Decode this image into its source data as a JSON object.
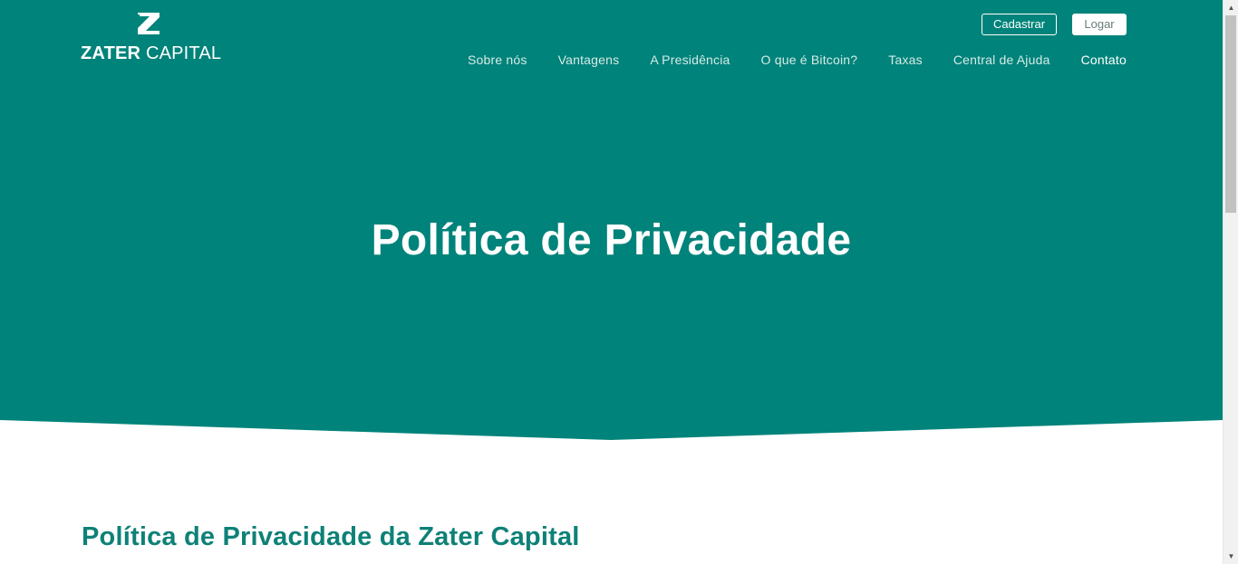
{
  "colors": {
    "brand_teal": "#00837a",
    "heading_teal": "#0e8177",
    "white": "#ffffff"
  },
  "header": {
    "logo_icon": "z-mark-icon",
    "logo_bold": "ZATER",
    "logo_light": "CAPITAL",
    "signup_label": "Cadastrar",
    "login_label": "Logar",
    "nav": [
      {
        "label": "Sobre nós"
      },
      {
        "label": "Vantagens"
      },
      {
        "label": "A Presidência"
      },
      {
        "label": "O que é Bitcoin?"
      },
      {
        "label": "Taxas"
      },
      {
        "label": "Central de Ajuda"
      },
      {
        "label": "Contato"
      }
    ]
  },
  "hero": {
    "title": "Política de Privacidade"
  },
  "content": {
    "section_title": "Política de Privacidade da Zater Capital"
  }
}
